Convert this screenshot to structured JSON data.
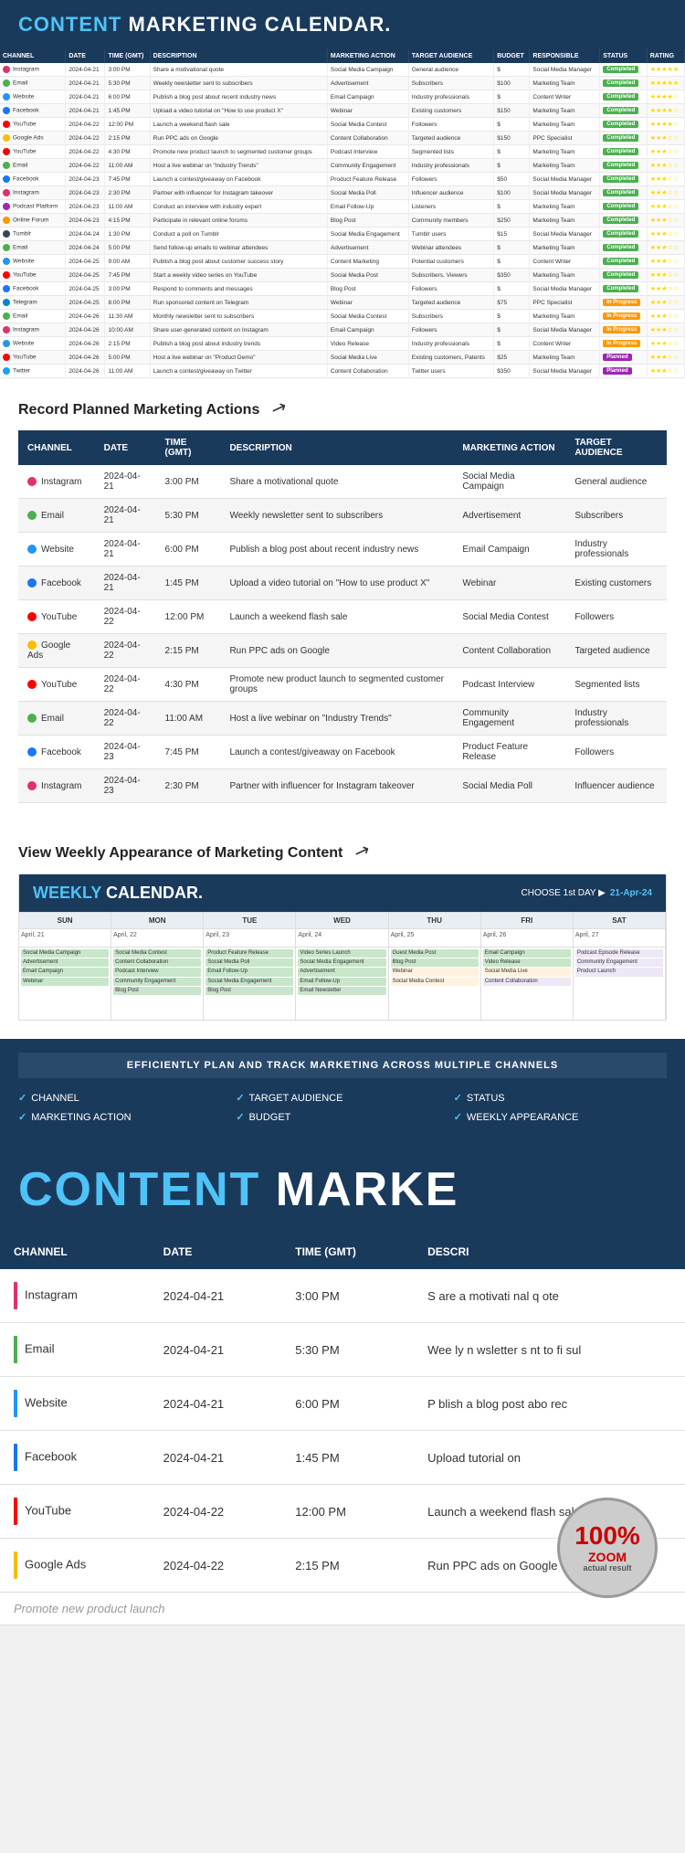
{
  "app": {
    "title": "CONTENT",
    "title2": " MARKETING CALENDAR.",
    "weekly_title": "WEEKLY",
    "weekly_title2": " CALENDAR."
  },
  "colors": {
    "instagram": "#E1306C",
    "email": "#4CAF50",
    "website": "#2196F3",
    "facebook": "#1877F2",
    "youtube": "#FF0000",
    "google_ads": "#FBBC05",
    "tumblr": "#35465C",
    "twitter": "#1DA1F2",
    "podcast": "#9C27B0",
    "online_forum": "#FF9800",
    "telegram": "#0088cc"
  },
  "spreadsheet": {
    "columns": [
      "CHANNEL",
      "DATE",
      "TIME (GMT)",
      "DESCRIPTION",
      "MARKETING ACTION",
      "TARGET AUDIENCE",
      "BUDGET",
      "RESPONSIBLE",
      "STATUS",
      "RATING"
    ],
    "rows": [
      {
        "channel": "Instagram",
        "color": "#E1306C",
        "date": "2024-04-21",
        "time": "3:00 PM",
        "desc": "Share a motivational quote",
        "action": "Social Media Campaign",
        "audience": "General audience",
        "budget": "$",
        "responsible": "Social Media Manager",
        "status": "Completed",
        "rating": 5
      },
      {
        "channel": "Email",
        "color": "#4CAF50",
        "date": "2024-04-21",
        "time": "5:30 PM",
        "desc": "Weekly newsletter sent to subscribers",
        "action": "Advertisement",
        "audience": "Subscribers",
        "budget": "$100",
        "responsible": "Marketing Team",
        "status": "Completed",
        "rating": 5
      },
      {
        "channel": "Website",
        "color": "#2196F3",
        "date": "2024-04-21",
        "time": "6:00 PM",
        "desc": "Publish a blog post about recent industry news",
        "action": "Email Campaign",
        "audience": "Industry professionals",
        "budget": "$",
        "responsible": "Content Writer",
        "status": "Completed",
        "rating": 4
      },
      {
        "channel": "Facebook",
        "color": "#1877F2",
        "date": "2024-04-21",
        "time": "1:45 PM",
        "desc": "Upload a video tutorial on \"How to use product X\"",
        "action": "Webinar",
        "audience": "Existing customers",
        "budget": "$150",
        "responsible": "Marketing Team",
        "status": "Completed",
        "rating": 4
      },
      {
        "channel": "YouTube",
        "color": "#FF0000",
        "date": "2024-04-22",
        "time": "12:00 PM",
        "desc": "Launch a weekend flash sale",
        "action": "Social Media Contest",
        "audience": "Followers",
        "budget": "$",
        "responsible": "Marketing Team",
        "status": "Completed",
        "rating": 4
      },
      {
        "channel": "Google Ads",
        "color": "#FBBC05",
        "date": "2024-04-22",
        "time": "2:15 PM",
        "desc": "Run PPC ads on Google",
        "action": "Content Collaboration",
        "audience": "Targeted audience",
        "budget": "$150",
        "responsible": "PPC Specialist",
        "status": "Completed",
        "rating": 3
      },
      {
        "channel": "YouTube",
        "color": "#FF0000",
        "date": "2024-04-22",
        "time": "4:30 PM",
        "desc": "Promote new product launch to segmented customer groups",
        "action": "Podcast Interview",
        "audience": "Segmented lists",
        "budget": "$",
        "responsible": "Marketing Team",
        "status": "Completed",
        "rating": 3
      },
      {
        "channel": "Email",
        "color": "#4CAF50",
        "date": "2024-04-22",
        "time": "11:00 AM",
        "desc": "Host a live webinar on \"Industry Trends\"",
        "action": "Community Engagement",
        "audience": "Industry professionals",
        "budget": "$",
        "responsible": "Marketing Team",
        "status": "Completed",
        "rating": 3
      },
      {
        "channel": "Facebook",
        "color": "#1877F2",
        "date": "2024-04-23",
        "time": "7:45 PM",
        "desc": "Launch a contest/giveaway on Facebook",
        "action": "Product Feature Release",
        "audience": "Followers",
        "budget": "$50",
        "responsible": "Social Media Manager",
        "status": "Completed",
        "rating": 3
      },
      {
        "channel": "Instagram",
        "color": "#E1306C",
        "date": "2024-04-23",
        "time": "2:30 PM",
        "desc": "Partner with influencer for Instagram takeover",
        "action": "Social Media Poll",
        "audience": "Influencer audience",
        "budget": "$100",
        "responsible": "Social Media Manager",
        "status": "Completed",
        "rating": 3
      },
      {
        "channel": "Podcast Platform",
        "color": "#9C27B0",
        "date": "2024-04-23",
        "time": "11:00 AM",
        "desc": "Conduct an interview with industry expert",
        "action": "Email Follow-Up",
        "audience": "Listeners",
        "budget": "$",
        "responsible": "Marketing Team",
        "status": "Completed",
        "rating": 3
      },
      {
        "channel": "Online Forum",
        "color": "#FF9800",
        "date": "2024-04-23",
        "time": "4:15 PM",
        "desc": "Participate in relevant online forums",
        "action": "Blog Post",
        "audience": "Community members",
        "budget": "$250",
        "responsible": "Marketing Team",
        "status": "Completed",
        "rating": 3
      },
      {
        "channel": "Tumblr",
        "color": "#35465C",
        "date": "2024-04-24",
        "time": "1:30 PM",
        "desc": "Conduct a poll on Tumblr",
        "action": "Social Media Engagement",
        "audience": "Tumblr users",
        "budget": "$15",
        "responsible": "Social Media Manager",
        "status": "Completed",
        "rating": 3
      },
      {
        "channel": "Email",
        "color": "#4CAF50",
        "date": "2024-04-24",
        "time": "5:00 PM",
        "desc": "Send follow-up emails to webinar attendees",
        "action": "Advertisement",
        "audience": "Webinar attendees",
        "budget": "$",
        "responsible": "Marketing Team",
        "status": "Completed",
        "rating": 3
      },
      {
        "channel": "Website",
        "color": "#2196F3",
        "date": "2024-04-25",
        "time": "9:00 AM",
        "desc": "Publish a blog post about customer success story",
        "action": "Content Marketing",
        "audience": "Potential customers",
        "budget": "$",
        "responsible": "Content Writer",
        "status": "Completed",
        "rating": 3
      },
      {
        "channel": "YouTube",
        "color": "#FF0000",
        "date": "2024-04-25",
        "time": "7:45 PM",
        "desc": "Start a weekly video series on YouTube",
        "action": "Social Media Post",
        "audience": "Subscribers, Viewers",
        "budget": "$350",
        "responsible": "Marketing Team",
        "status": "Completed",
        "rating": 3
      },
      {
        "channel": "Facebook",
        "color": "#1877F2",
        "date": "2024-04-25",
        "time": "3:00 PM",
        "desc": "Respond to comments and messages",
        "action": "Blog Post",
        "audience": "Followers",
        "budget": "$",
        "responsible": "Social Media Manager",
        "status": "Completed",
        "rating": 3
      },
      {
        "channel": "Telegram",
        "color": "#0088cc",
        "date": "2024-04-25",
        "time": "8:00 PM",
        "desc": "Run sponsored content on Telegram",
        "action": "Webinar",
        "audience": "Targeted audience",
        "budget": "$75",
        "responsible": "PPC Specialist",
        "status": "In Progress",
        "rating": 3
      },
      {
        "channel": "Email",
        "color": "#4CAF50",
        "date": "2024-04-26",
        "time": "11:30 AM",
        "desc": "Monthly newsletter sent to subscribers",
        "action": "Social Media Contest",
        "audience": "Subscribers",
        "budget": "$",
        "responsible": "Marketing Team",
        "status": "In Progress",
        "rating": 3
      },
      {
        "channel": "Instagram",
        "color": "#E1306C",
        "date": "2024-04-26",
        "time": "10:00 AM",
        "desc": "Share user-generated content on Instagram",
        "action": "Email Campaign",
        "audience": "Followers",
        "budget": "$",
        "responsible": "Social Media Manager",
        "status": "In Progress",
        "rating": 3
      },
      {
        "channel": "Website",
        "color": "#2196F3",
        "date": "2024-04-26",
        "time": "2:15 PM",
        "desc": "Publish a blog post about industry trends",
        "action": "Video Release",
        "audience": "Industry professionals",
        "budget": "$",
        "responsible": "Content Writer",
        "status": "In Progress",
        "rating": 3
      },
      {
        "channel": "YouTube",
        "color": "#FF0000",
        "date": "2024-04-26",
        "time": "5:00 PM",
        "desc": "Host a live webinar on \"Product Demo\"",
        "action": "Social Media Live",
        "audience": "Existing customers, Patents",
        "budget": "$25",
        "responsible": "Marketing Team",
        "status": "Planned",
        "rating": 3
      },
      {
        "channel": "Twitter",
        "color": "#1DA1F2",
        "date": "2024-04-26",
        "time": "11:00 AM",
        "desc": "Launch a contest/giveaway on Twitter",
        "action": "Content Collaboration",
        "audience": "Twitter users",
        "budget": "$350",
        "responsible": "Social Media Manager",
        "status": "Planned",
        "rating": 3
      }
    ]
  },
  "section2": {
    "title": "Record Planned Marketing Actions",
    "columns": [
      "CHANNEL",
      "DATE",
      "TIME (GMT)",
      "DESCRIPTION",
      "MARKETING ACTION",
      "TARGET AUDIENCE"
    ],
    "rows": [
      {
        "channel": "Instagram",
        "color": "#E1306C",
        "date": "2024-04-21",
        "time": "3:00 PM",
        "desc": "Share a motivational quote",
        "action": "Social Media Campaign",
        "audience": "General audience"
      },
      {
        "channel": "Email",
        "color": "#4CAF50",
        "date": "2024-04-21",
        "time": "5:30 PM",
        "desc": "Weekly newsletter sent to subscribers",
        "action": "Advertisement",
        "audience": "Subscribers"
      },
      {
        "channel": "Website",
        "color": "#2196F3",
        "date": "2024-04-21",
        "time": "6:00 PM",
        "desc": "Publish a blog post about recent industry news",
        "action": "Email Campaign",
        "audience": "Industry professionals"
      },
      {
        "channel": "Facebook",
        "color": "#1877F2",
        "date": "2024-04-21",
        "time": "1:45 PM",
        "desc": "Upload a video tutorial on \"How to use product X\"",
        "action": "Webinar",
        "audience": "Existing customers"
      },
      {
        "channel": "YouTube",
        "color": "#FF0000",
        "date": "2024-04-22",
        "time": "12:00 PM",
        "desc": "Launch a weekend flash sale",
        "action": "Social Media Contest",
        "audience": "Followers"
      },
      {
        "channel": "Google Ads",
        "color": "#FBBC05",
        "date": "2024-04-22",
        "time": "2:15 PM",
        "desc": "Run PPC ads on Google",
        "action": "Content Collaboration",
        "audience": "Targeted audience"
      },
      {
        "channel": "YouTube",
        "color": "#FF0000",
        "date": "2024-04-22",
        "time": "4:30 PM",
        "desc": "Promote new product launch to segmented customer groups",
        "action": "Podcast Interview",
        "audience": "Segmented lists"
      },
      {
        "channel": "Email",
        "color": "#4CAF50",
        "date": "2024-04-22",
        "time": "11:00 AM",
        "desc": "Host a live webinar on \"Industry Trends\"",
        "action": "Community Engagement",
        "audience": "Industry professionals"
      },
      {
        "channel": "Facebook",
        "color": "#1877F2",
        "date": "2024-04-23",
        "time": "7:45 PM",
        "desc": "Launch a contest/giveaway on Facebook",
        "action": "Product Feature Release",
        "audience": "Followers"
      },
      {
        "channel": "Instagram",
        "color": "#E1306C",
        "date": "2024-04-23",
        "time": "2:30 PM",
        "desc": "Partner with influencer for Instagram takeover",
        "action": "Social Media Poll",
        "audience": "Influencer audience"
      }
    ]
  },
  "section3": {
    "title": "View Weekly Appearance of Marketing Content",
    "choose_label": "CHOOSE 1st DAY ▶",
    "date_value": "21-Apr-24",
    "days": [
      "SUN",
      "MON",
      "TUE",
      "WED",
      "THU",
      "FRI",
      "SAT"
    ],
    "dates": [
      "April, 21",
      "April, 22",
      "April, 23",
      "April, 24",
      "April, 25",
      "April, 26",
      "April, 27"
    ],
    "cells": [
      [
        {
          "text": "Social Media Campaign",
          "status": "completed"
        },
        {
          "text": "Advertisement",
          "status": "completed"
        },
        {
          "text": "Email Campaign",
          "status": "completed"
        },
        {
          "text": "Webinar",
          "status": "completed"
        }
      ],
      [
        {
          "text": "Social Media Contest",
          "status": "completed"
        },
        {
          "text": "Content Collaboration",
          "status": "completed"
        },
        {
          "text": "Podcast Interview",
          "status": "completed"
        },
        {
          "text": "Community Engagement",
          "status": "completed"
        },
        {
          "text": "Blog Post",
          "status": "completed"
        }
      ],
      [
        {
          "text": "Product Feature Release",
          "status": "completed"
        },
        {
          "text": "Social Media Poll",
          "status": "completed"
        },
        {
          "text": "Email Follow-Up",
          "status": "completed"
        },
        {
          "text": "Social Media Engagement",
          "status": "completed"
        },
        {
          "text": "Blog Post",
          "status": "completed"
        }
      ],
      [
        {
          "text": "Video Series Launch",
          "status": "completed"
        },
        {
          "text": "Social Media Engagement",
          "status": "completed"
        },
        {
          "text": "Advertisement",
          "status": "completed"
        },
        {
          "text": "Email Follow-Up",
          "status": "completed"
        },
        {
          "text": "Email Newsletter",
          "status": "completed"
        }
      ],
      [
        {
          "text": "Guest Media Post",
          "status": "completed"
        },
        {
          "text": "Blog Post",
          "status": "completed"
        },
        {
          "text": "Webinar",
          "status": "in-progress"
        },
        {
          "text": "Social Media Contest",
          "status": "in-progress"
        }
      ],
      [
        {
          "text": "Email Campaign",
          "status": "completed"
        },
        {
          "text": "Video Release",
          "status": "completed"
        },
        {
          "text": "Social Media Live",
          "status": "in-progress"
        },
        {
          "text": "Content Collaboration",
          "status": "planned"
        }
      ],
      [
        {
          "text": "Podcast Episode Release",
          "status": "planned"
        },
        {
          "text": "Community Engagement",
          "status": "planned"
        },
        {
          "text": "Product Launch",
          "status": "planned"
        }
      ]
    ]
  },
  "section4": {
    "banner": "EFFICIENTLY PLAN AND TRACK MARKETING ACROSS MULTIPLE CHANNELS",
    "features": [
      {
        "check": "✓",
        "text": "CHANNEL"
      },
      {
        "check": "✓",
        "text": "TARGET AUDIENCE"
      },
      {
        "check": "✓",
        "text": "STATUS"
      },
      {
        "check": "✓",
        "text": "MARKETING ACTION"
      },
      {
        "check": "✓",
        "text": "BUDGET"
      },
      {
        "check": "✓",
        "text": "WEEKLY APPEARANCE"
      }
    ]
  },
  "section5": {
    "line1": "CONTENT",
    "line2": "MARKE"
  },
  "section6": {
    "columns": [
      "CHANNEL",
      "DATE",
      "TIME (GMT)",
      "DESCRI"
    ],
    "rows": [
      {
        "channel": "Instagram",
        "color": "#E1306C",
        "date": "2024-04-21",
        "time": "3:00 PM",
        "desc": "S are a motivati nal q ote"
      },
      {
        "channel": "Email",
        "color": "#4CAF50",
        "date": "2024-04-21",
        "time": "5:30 PM",
        "desc": "Wee ly n wsletter s nt to fi sul"
      },
      {
        "channel": "Website",
        "color": "#2196F3",
        "date": "2024-04-21",
        "time": "6:00 PM",
        "desc": "P blish a blog post abo rec"
      },
      {
        "channel": "Facebook",
        "color": "#1877F2",
        "date": "2024-04-21",
        "time": "1:45 PM",
        "desc": "Upload   tutorial on"
      },
      {
        "channel": "YouTube",
        "color": "#FF0000",
        "date": "2024-04-22",
        "time": "12:00 PM",
        "desc": "Launch a weekend flash sale"
      },
      {
        "channel": "Google Ads",
        "color": "#FBBC05",
        "date": "2024-04-22",
        "time": "2:15 PM",
        "desc": "Run PPC ads on Google"
      },
      {
        "channel": "",
        "color": "transparent",
        "date": "",
        "time": "",
        "desc": "Promote new product launch"
      }
    ]
  },
  "zoom_badge": {
    "percent": "100%",
    "label": "ZOOM",
    "sub": "actual result"
  }
}
